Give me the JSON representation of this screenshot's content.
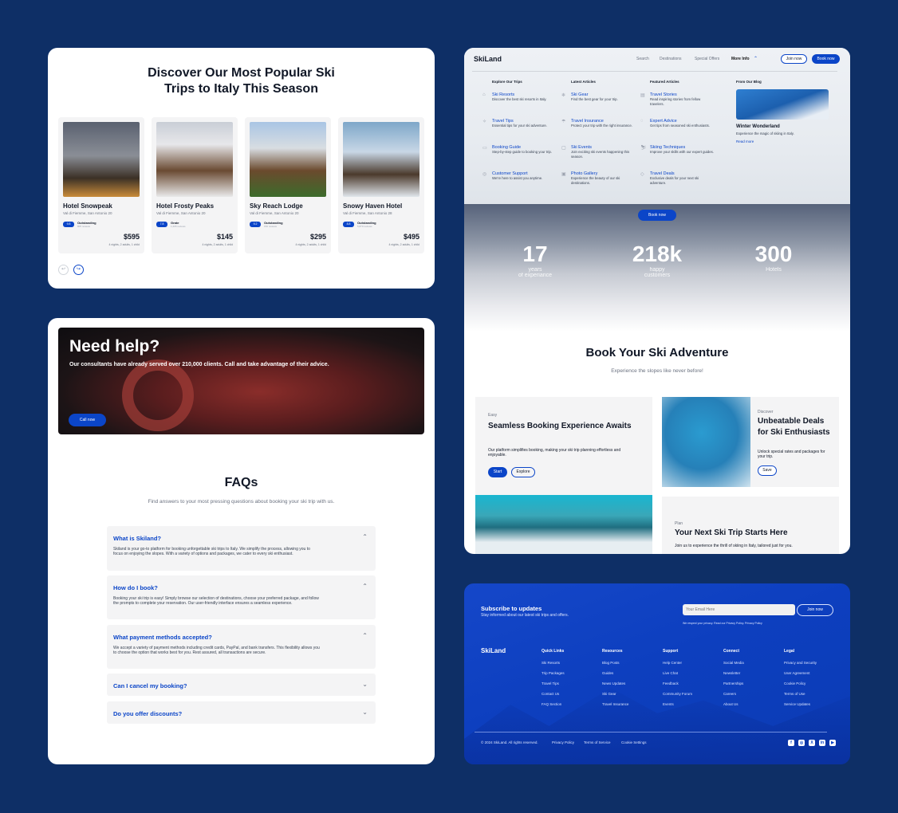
{
  "colors": {
    "background": "#0e2f66",
    "accent": "#0b45c8",
    "card": "#f4f4f5"
  },
  "popular": {
    "title": "Discover Our Most Popular Ski Trips to Italy This Season",
    "hotels": [
      {
        "name": "Hotel Snowpeak",
        "address": "Val di Fiemme, San Antonio 20",
        "score": "9.8",
        "rating": "Outstanding",
        "reviews": "805 reviews",
        "price": "$595",
        "details": "4 nights, 2 adults, 1 child"
      },
      {
        "name": "Hotel Frosty Peaks",
        "address": "Val di Fiemme, San Antonio 20",
        "score": "7.8",
        "rating": "Grate",
        "reviews": "1,205 reviews",
        "price": "$145",
        "details": "4 nights, 2 adults, 1 child"
      },
      {
        "name": "Sky Reach Lodge",
        "address": "Val di Fiemme, San Antonio 20",
        "score": "9.2",
        "rating": "Outstanding",
        "reviews": "150 reviews",
        "price": "$295",
        "details": "4 nights, 2 adults, 1 child"
      },
      {
        "name": "Snowy Haven Hotel",
        "address": "Val di Fiemme, San Antonio 28",
        "score": "8.8",
        "rating": "Outstanding",
        "reviews": "5,870 reviews",
        "price": "$495",
        "details": "4 nights, 2 adults, 1 child"
      }
    ],
    "prev_icon": "arrow-left-icon",
    "next_icon": "arrow-right-icon"
  },
  "help": {
    "title": "Need help?",
    "subtitle": "Our consultants have already served over 210,000 clients. Call and take advantage of their advice.",
    "cta": "Call now"
  },
  "faqs": {
    "title": "FAQs",
    "subtitle": "Find answers to your most pressing questions about booking your ski trip with us.",
    "items": [
      {
        "q": "What is Skiland?",
        "a": "Skiland is your go-to platform for booking unforgettable ski trips to Italy. We simplify the process, allowing you to focus on enjoying the slopes. With a variety of options and packages, we cater to every ski enthusiast.",
        "open": true
      },
      {
        "q": "How do I book?",
        "a": "Booking your ski trip is easy! Simply browse our selection of destinations, choose your preferred package, and follow the prompts to complete your reservation. Our user-friendly interface ensures a seamless experience.",
        "open": true
      },
      {
        "q": "What payment methods accepted?",
        "a": "We accept a variety of payment methods including credit cards, PayPal, and bank transfers. This flexibility allows you to choose the option that works best for you. Rest assured, all transactions are secure.",
        "open": true
      },
      {
        "q": "Can I cancel my booking?",
        "a": "",
        "open": false
      },
      {
        "q": "Do you offer discounts?",
        "a": "",
        "open": false
      }
    ]
  },
  "site": {
    "logo": "SkiLand",
    "nav": [
      "Search",
      "Destinations",
      "Special Offers",
      "More Info"
    ],
    "join": "Join now",
    "book": "Book now",
    "menu": [
      {
        "header": "Explore Our Trips",
        "items": [
          {
            "icon": "home-icon",
            "t": "Ski Resorts",
            "d": "Discover the best ski resorts in Italy."
          },
          {
            "icon": "compass-icon",
            "t": "Travel Tips",
            "d": "Essential tips for your ski adventure."
          },
          {
            "icon": "book-icon",
            "t": "Booking Guide",
            "d": "Step-by-step guide to booking your trip."
          },
          {
            "icon": "support-icon",
            "t": "Customer Support",
            "d": "We're here to assist you anytime."
          }
        ]
      },
      {
        "header": "Latest Articles",
        "items": [
          {
            "icon": "snowflake-icon",
            "t": "Ski Gear",
            "d": "Find the best gear for your trip."
          },
          {
            "icon": "umbrella-icon",
            "t": "Travel Insurance",
            "d": "Protect your trip with the right insurance."
          },
          {
            "icon": "calendar-icon",
            "t": "Ski Events",
            "d": "Join exciting ski events happening this season."
          },
          {
            "icon": "image-icon",
            "t": "Photo Gallery",
            "d": "Experience the beauty of our ski destinations."
          }
        ]
      },
      {
        "header": "Featured Articles",
        "items": [
          {
            "icon": "document-icon",
            "t": "Travel Stories",
            "d": "Read inspiring stories from fellow travelers."
          },
          {
            "icon": "chat-icon",
            "t": "Expert Advice",
            "d": "Get tips from seasoned ski enthusiasts."
          },
          {
            "icon": "skier-icon",
            "t": "Skiing Techniques",
            "d": "Improve your skills with our expert guides."
          },
          {
            "icon": "tag-icon",
            "t": "Travel Deals",
            "d": "Exclusive deals for your next ski adventure."
          }
        ]
      }
    ],
    "blog": {
      "header": "From Our Blog",
      "title": "Winter Wonderland",
      "desc": "Experience the magic of skiing in Italy.",
      "link": "Read more"
    },
    "hero_cta": "Book now",
    "stats": [
      {
        "n": "17",
        "l1": "years",
        "l2": "of experiance"
      },
      {
        "n": "218k",
        "l1": "happy",
        "l2": "customers"
      },
      {
        "n": "300",
        "l1": "Hotels",
        "l2": ""
      }
    ],
    "adventure": {
      "title": "Book Your Ski Adventure",
      "subtitle": "Experience the slopes like never before!",
      "card1": {
        "tag": "Easy",
        "title": "Seamless Booking Experience Awaits",
        "desc": "Our platform simplifies booking, making your ski trip planning effortless and enjoyable.",
        "primary": "Start",
        "secondary": "Explore"
      },
      "card2": {
        "tag": "Discover",
        "title": "Unbeatable Deals for Ski Enthusiasts",
        "desc": "Unlock special rates and packages for your trip.",
        "btn": "Save"
      },
      "card3": {
        "tag": "Plan",
        "title": "Your Next Ski Trip Starts Here",
        "desc": "Join us to experience the thrill of skiing in Italy, tailored just for you."
      }
    }
  },
  "footer": {
    "sub_title": "Subscribe to updates",
    "sub_desc": "Stay informed about our latest ski trips and offers.",
    "email_placeholder": "Your Email Here",
    "join": "Join now",
    "privacy": "We respect your privacy. Read our Privacy Policy. Privacy Policy",
    "logo": "SkiLand",
    "columns": [
      {
        "h": "Quick Links",
        "items": [
          "Ski Resorts",
          "Trip Packages",
          "Travel Tips",
          "Contact Us",
          "FAQ Section"
        ]
      },
      {
        "h": "Resources",
        "items": [
          "Blog Posts",
          "Guides",
          "News Updates",
          "Ski Gear",
          "Travel Insurance"
        ]
      },
      {
        "h": "Support",
        "items": [
          "Help Center",
          "Live Chat",
          "Feedback",
          "Community Forum",
          "Events"
        ]
      },
      {
        "h": "Connect",
        "items": [
          "Social Media",
          "Newsletter",
          "Partnerships",
          "Careers",
          "About Us"
        ]
      },
      {
        "h": "Legal",
        "items": [
          "Privacy and Security",
          "User Agreement",
          "Cookie Policy",
          "Terms of Use",
          "Service Updates"
        ]
      }
    ],
    "copyright": "© 2024 SkiLand. All rights reserved.",
    "links": [
      "Privacy Policy",
      "Terms of Service",
      "Cookie Settings"
    ],
    "social": [
      "facebook-icon",
      "instagram-icon",
      "x-icon",
      "linkedin-icon",
      "youtube-icon"
    ]
  }
}
